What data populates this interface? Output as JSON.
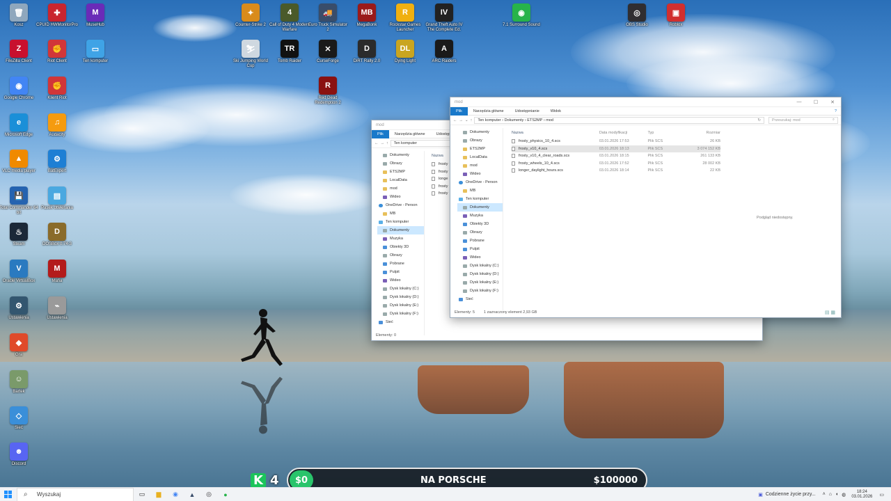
{
  "desktop": {
    "icons_left": [
      {
        "label": "Kosz",
        "icon": "recycle-bin-icon",
        "color": "#8fa7bd",
        "glyph": "🗑"
      },
      {
        "label": "CPUID HWMonitorPro",
        "icon": "cpuid-icon",
        "color": "#c9252f",
        "glyph": "✚"
      },
      {
        "label": "MuseHub",
        "icon": "musehub-icon",
        "color": "#6a2bb8",
        "glyph": "M"
      },
      {
        "label": "FileZilla Client",
        "icon": "filezilla-icon",
        "color": "#c8102e",
        "glyph": "Z"
      },
      {
        "label": "Riot Client",
        "icon": "riot-icon",
        "color": "#d13639",
        "glyph": "✊"
      },
      {
        "label": "Ten komputer",
        "icon": "this-pc-icon",
        "color": "#3fa3e6",
        "glyph": "▭"
      },
      {
        "label": "Google Chrome",
        "icon": "chrome-icon",
        "color": "#4285f4",
        "glyph": "◉"
      },
      {
        "label": "Klient Riot",
        "icon": "riot-client-icon",
        "color": "#d13639",
        "glyph": "✊"
      },
      {
        "label": "Microsoft Edge",
        "icon": "edge-icon",
        "color": "#1a8fd8",
        "glyph": "e"
      },
      {
        "label": "Audacity",
        "icon": "audacity-icon",
        "color": "#f59b0f",
        "glyph": "♫"
      },
      {
        "label": "VLC media player",
        "icon": "vlc-icon",
        "color": "#f08a00",
        "glyph": "▲"
      },
      {
        "label": "BatExpert",
        "icon": "batexpert-icon",
        "color": "#1e7fd4",
        "glyph": "⚙"
      },
      {
        "label": "Total Commander 64 bit",
        "icon": "total-commander-icon",
        "color": "#2563b0",
        "glyph": "💾"
      },
      {
        "label": "Pasek otwierania",
        "icon": "panel-icon",
        "color": "#4aa8e0",
        "glyph": "▤"
      },
      {
        "label": "Steam",
        "icon": "steam-icon",
        "color": "#1b2838",
        "glyph": "♨"
      },
      {
        "label": "DOSBox 0.74-3",
        "icon": "dosbox-icon",
        "color": "#8a6b2a",
        "glyph": "D"
      },
      {
        "label": "Oracle VirtualBox",
        "icon": "virtualbox-icon",
        "color": "#2a7ac0",
        "glyph": "V"
      },
      {
        "label": "Mafia",
        "icon": "mafia-icon",
        "color": "#b31b1b",
        "glyph": "M"
      },
      {
        "label": "Ustawienia",
        "icon": "settings-app-icon",
        "color": "#33566f",
        "glyph": "⚙"
      },
      {
        "label": "Ustawienia",
        "icon": "network-tool-icon",
        "color": "#9a9a9a",
        "glyph": "⌁"
      },
      {
        "label": "Gra",
        "icon": "game-app-icon",
        "color": "#e04a2a",
        "glyph": "◆"
      },
      {
        "label": "Bartek",
        "icon": "user-folder-icon",
        "color": "#7a9a6a",
        "glyph": "☺"
      },
      {
        "label": "Sieć",
        "icon": "network-icon",
        "color": "#3a8fd9",
        "glyph": "◇"
      },
      {
        "label": "Discord",
        "icon": "discord-icon",
        "color": "#5865f2",
        "glyph": "☻"
      }
    ],
    "icons_top": [
      {
        "label": "Counter-Strike 2",
        "icon": "cs2-icon",
        "color": "#d98b1b",
        "glyph": "✦"
      },
      {
        "label": "Call of Duty 4 Modern Warfare",
        "icon": "cod4-icon",
        "color": "#4a5a2a",
        "glyph": "4"
      },
      {
        "label": "Euro Truck Simulator 2",
        "icon": "ets2-icon",
        "color": "#394d6a",
        "glyph": "🚚"
      },
      {
        "label": "MegaBonk",
        "icon": "megabonk-icon",
        "color": "#9a1a1a",
        "glyph": "MB"
      },
      {
        "label": "Rockstar Games Launcher",
        "icon": "rockstar-icon",
        "color": "#f0b010",
        "glyph": "R"
      },
      {
        "label": "Grand Theft Auto IV The Complete Ed.",
        "icon": "gta4-icon",
        "color": "#222222",
        "glyph": "IV"
      },
      {
        "label": "7.1 Surround Sound",
        "icon": "surround-icon",
        "color": "#27b34a",
        "glyph": "◉"
      },
      {
        "label": "OBS Studio",
        "icon": "obs-icon",
        "color": "#302e31",
        "glyph": "◎"
      },
      {
        "label": "Roblox",
        "icon": "roblox-icon",
        "color": "#d12f2f",
        "glyph": "▣"
      },
      {
        "label": "Ski Jumping World Cup",
        "icon": "ski-jumping-icon",
        "color": "#cfd8e0",
        "glyph": "⛷"
      },
      {
        "label": "Tomb Raider",
        "icon": "tomb-raider-icon",
        "color": "#111111",
        "glyph": "TR"
      },
      {
        "label": "CurseForge",
        "icon": "curseforge-icon",
        "color": "#1a1a1a",
        "glyph": "✕"
      },
      {
        "label": "DiRT Rally 2.0",
        "icon": "dirt-rally-icon",
        "color": "#2b2b2b",
        "glyph": "D"
      },
      {
        "label": "Dying Light",
        "icon": "dying-light-icon",
        "color": "#c9a520",
        "glyph": "DL"
      },
      {
        "label": "ARC Raiders",
        "icon": "arc-raiders-icon",
        "color": "#1a1a1a",
        "glyph": "A"
      },
      {
        "label": "Red Dead Redemption 2",
        "icon": "rdr2-icon",
        "color": "#8a1111",
        "glyph": "R"
      }
    ]
  },
  "explorer_back": {
    "title": "mod",
    "ribbon": [
      "Plik",
      "Narzędzia główne",
      "Udostępnianie"
    ],
    "path": "Ten komputer",
    "nav": [
      "Dokumenty",
      "Obrazy",
      "ETS2MP",
      "LocalData",
      "mod",
      "Wideo",
      "OneDrive - Person",
      "MB",
      "Ten komputer",
      "Dokumenty",
      "Muzyka",
      "Obiekty 3D",
      "Obrazy",
      "Pobrane",
      "Pulpit",
      "Wideo",
      "Dysk lokalny (C:)",
      "Dysk lokalny (D:)",
      "Dysk lokalny (E:)",
      "Dysk lokalny (F:)",
      "Sieć"
    ],
    "col_name": "Nazwa",
    "files": [
      "frosty",
      "frosty",
      "longe",
      "frosty",
      "frosty"
    ],
    "status": "Elementy: 0"
  },
  "explorer_front": {
    "title": "mod",
    "ribbon": [
      "Plik",
      "Narzędzia główne",
      "Udostępnianie",
      "Widok"
    ],
    "path": [
      "Ten komputer",
      "Dokumenty",
      "ETS2MP",
      "mod"
    ],
    "search_placeholder": "Przeszukaj: mod",
    "nav": [
      "Dokumenty",
      "Obrazy",
      "ETS2MP",
      "LocalData",
      "mod",
      "Wideo",
      "OneDrive - Person",
      "MB",
      "Ten komputer",
      "Dokumenty",
      "Muzyka",
      "Obiekty 3D",
      "Obrazy",
      "Pobrane",
      "Pulpit",
      "Wideo",
      "Dysk lokalny (C:)",
      "Dysk lokalny (D:)",
      "Dysk lokalny (E:)",
      "Dysk lokalny (F:)",
      "Sieć"
    ],
    "columns": [
      "Nazwa",
      "Data modyfikacji",
      "Typ",
      "Rozmiar"
    ],
    "files": [
      {
        "name": "frosty_physics_10_4.scs",
        "date": "03.01.2026 17:53",
        "type": "Plik SCS",
        "size": "26 KB"
      },
      {
        "name": "frosty_v10_4.scs",
        "date": "03.01.2026 18:13",
        "type": "Plik SCS",
        "size": "3 074 152 KB"
      },
      {
        "name": "frosty_v10_4_clear_roads.scs",
        "date": "03.01.2026 18:15",
        "type": "Plik SCS",
        "size": "261 133 KB"
      },
      {
        "name": "frosty_wheels_10_4.scs",
        "date": "03.01.2026 17:52",
        "type": "Plik SCS",
        "size": "28 002 KB"
      },
      {
        "name": "longer_daylight_hours.scs",
        "date": "03.01.2026 18:14",
        "type": "Plik SCS",
        "size": "22 KB"
      }
    ],
    "preview": "Podgląd niedostępny.",
    "status_count": "Elementy: 5",
    "status_sel": "1 zaznaczony element  2,93 GB"
  },
  "overlay": {
    "rank_letter": "K",
    "rank_number": "4",
    "money": "$0",
    "goal": "NA PORSCHE",
    "prize": "$100000"
  },
  "taskbar": {
    "search_placeholder": "Wyszukaj",
    "news": "Codzienne życie przy...",
    "time": "18:24",
    "date": "03.01.2026"
  }
}
